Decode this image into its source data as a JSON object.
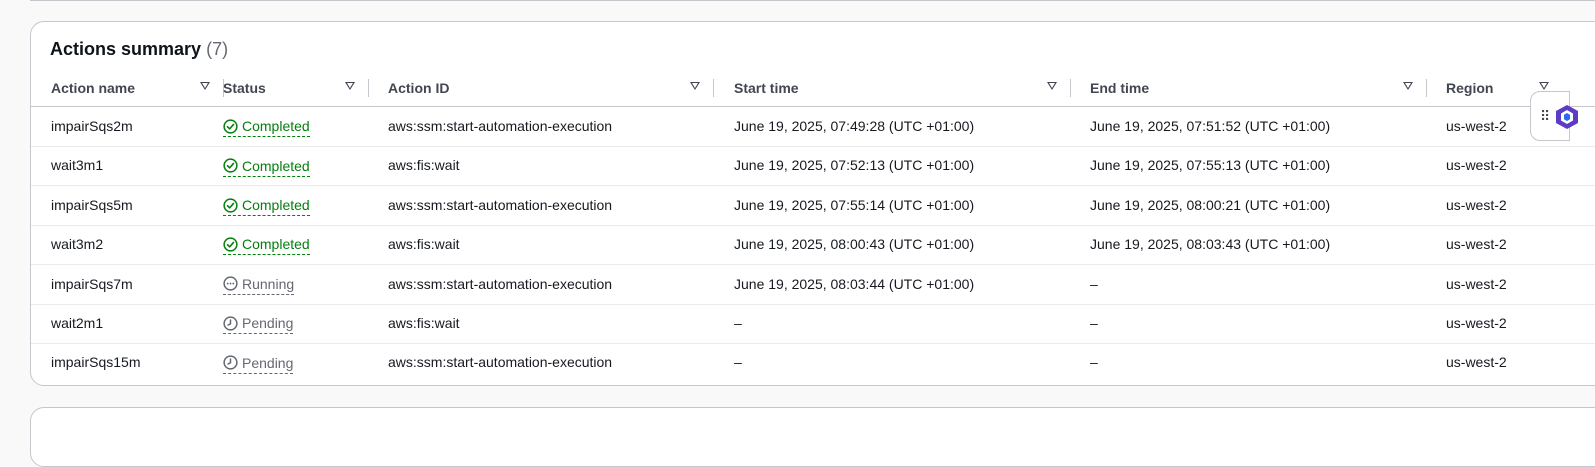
{
  "panel": {
    "title": "Actions summary",
    "count": "(7)"
  },
  "columns": [
    {
      "label": "Action name"
    },
    {
      "label": "Status"
    },
    {
      "label": "Action ID"
    },
    {
      "label": "Start time"
    },
    {
      "label": "End time"
    },
    {
      "label": "Region"
    }
  ],
  "rows": [
    {
      "name": "impairSqs2m",
      "status": "Completed",
      "status_kind": "completed",
      "action_id": "aws:ssm:start-automation-execution",
      "start": "June 19, 2025, 07:49:28 (UTC +01:00)",
      "end": "June 19, 2025, 07:51:52 (UTC +01:00)",
      "region": "us-west-2"
    },
    {
      "name": "wait3m1",
      "status": "Completed",
      "status_kind": "completed",
      "action_id": "aws:fis:wait",
      "start": "June 19, 2025, 07:52:13 (UTC +01:00)",
      "end": "June 19, 2025, 07:55:13 (UTC +01:00)",
      "region": "us-west-2"
    },
    {
      "name": "impairSqs5m",
      "status": "Completed",
      "status_kind": "completed",
      "action_id": "aws:ssm:start-automation-execution",
      "start": "June 19, 2025, 07:55:14 (UTC +01:00)",
      "end": "June 19, 2025, 08:00:21 (UTC +01:00)",
      "region": "us-west-2"
    },
    {
      "name": "wait3m2",
      "status": "Completed",
      "status_kind": "completed",
      "action_id": "aws:fis:wait",
      "start": "June 19, 2025, 08:00:43 (UTC +01:00)",
      "end": "June 19, 2025, 08:03:43 (UTC +01:00)",
      "region": "us-west-2"
    },
    {
      "name": "impairSqs7m",
      "status": "Running",
      "status_kind": "running",
      "action_id": "aws:ssm:start-automation-execution",
      "start": "June 19, 2025, 08:03:44 (UTC +01:00)",
      "end": "–",
      "region": "us-west-2"
    },
    {
      "name": "wait2m1",
      "status": "Pending",
      "status_kind": "pending",
      "action_id": "aws:fis:wait",
      "start": "–",
      "end": "–",
      "region": "us-west-2"
    },
    {
      "name": "impairSqs15m",
      "status": "Pending",
      "status_kind": "pending",
      "action_id": "aws:ssm:start-automation-execution",
      "start": "–",
      "end": "–",
      "region": "us-west-2"
    }
  ],
  "icons": {
    "completed": "check-circle-icon",
    "running": "ellipsis-circle-icon",
    "pending": "clock-icon",
    "sort": "caret-down-icon",
    "drag": "drag-handle-icon",
    "assistant": "hexagon-logo-icon"
  },
  "colors": {
    "completed": "#037f0c",
    "running": "#656871",
    "pending": "#656871",
    "border": "#c6c6cd",
    "accent": "#5b3cc4"
  }
}
